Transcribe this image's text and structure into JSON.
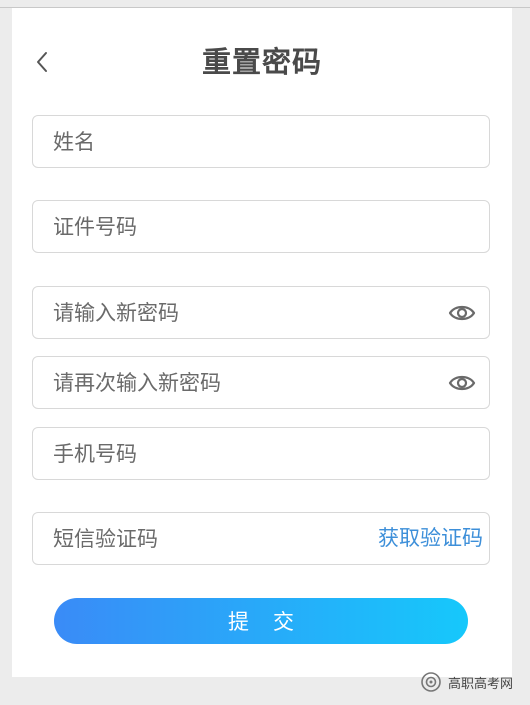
{
  "header": {
    "title": "重置密码"
  },
  "form": {
    "name": {
      "placeholder": "姓名",
      "value": ""
    },
    "id_number": {
      "placeholder": "证件号码",
      "value": ""
    },
    "new_password": {
      "placeholder": "请输入新密码",
      "value": ""
    },
    "confirm_password": {
      "placeholder": "请再次输入新密码",
      "value": ""
    },
    "phone": {
      "placeholder": "手机号码",
      "value": ""
    },
    "sms_code": {
      "placeholder": "短信验证码",
      "value": ""
    },
    "get_code_label": "获取验证码",
    "submit_label": "提交"
  },
  "watermark": {
    "text": "高职高考网",
    "icon": "wechat-official-account-icon"
  },
  "colors": {
    "accent_link": "#3d8fd9",
    "button_gradient_start": "#3a8bf7",
    "button_gradient_end": "#16c8fb",
    "title_text": "#4a4a4a",
    "field_border": "#d8d8d8",
    "page_background": "#ececec"
  }
}
